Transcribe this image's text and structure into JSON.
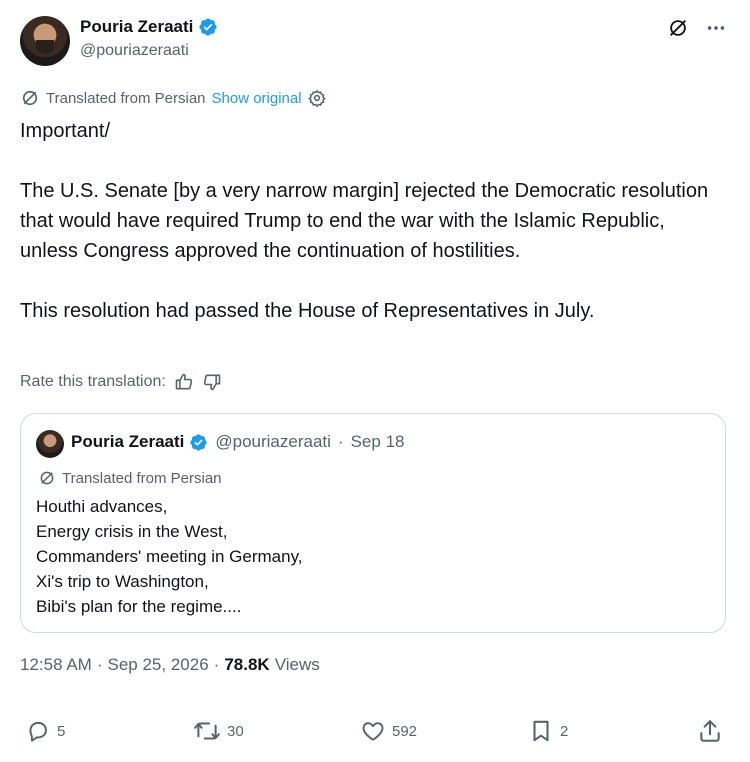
{
  "author": {
    "name": "Pouria Zeraati",
    "handle": "@pouriazeraati"
  },
  "translation_bar": {
    "text": "Translated from Persian",
    "show_original": "Show original"
  },
  "tweet": {
    "text": "Important/\n\nThe U.S. Senate [by a very narrow margin] rejected the Democratic resolution that would have required Trump to end the war with the Islamic Republic, unless Congress approved the continuation of hostilities.\n\nThis resolution had passed the House of Representatives in July."
  },
  "rate": {
    "label": "Rate this translation:"
  },
  "quote": {
    "name": "Pouria Zeraati",
    "handle": "@pouriazeraati",
    "dot": "·",
    "date": "Sep 18",
    "translated": "Translated from Persian",
    "text": "Houthi advances,\nEnergy crisis in the West,\nCommanders' meeting in Germany,\nXi's trip to Washington,\nBibi's plan for the regime...."
  },
  "meta": {
    "time": "12:58 AM",
    "dot": "·",
    "date": "Sep 25, 2026",
    "views_count": "78.8K",
    "views_label": "Views"
  },
  "actions": {
    "replies": "5",
    "reposts": "30",
    "likes": "592",
    "bookmarks": "2"
  },
  "colors": {
    "accent": "#1d9bf0",
    "muted": "#536471",
    "text": "#0f1419",
    "border": "#cfd9de"
  }
}
